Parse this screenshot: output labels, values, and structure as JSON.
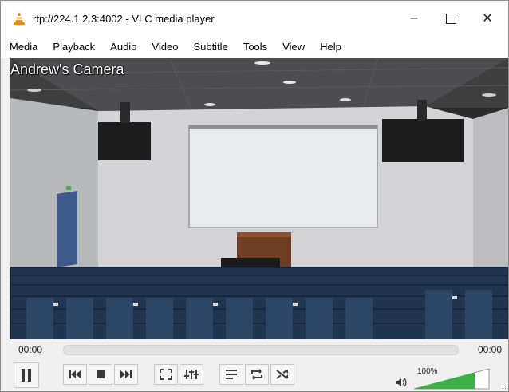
{
  "window": {
    "title": "rtp://224.1.2.3:4002 - VLC media player",
    "min_glyph": "–",
    "close_glyph": "✕"
  },
  "menu": {
    "items": [
      "Media",
      "Playback",
      "Audio",
      "Video",
      "Subtitle",
      "Tools",
      "View",
      "Help"
    ]
  },
  "video": {
    "overlay_text": "Andrew's Camera"
  },
  "seek": {
    "elapsed": "00:00",
    "total": "00:00",
    "progress": 0.0
  },
  "volume": {
    "label": "100%",
    "level": 1.0
  },
  "icons": {
    "app": "vlc-cone-icon",
    "pause": "pause-icon",
    "prev": "previous-icon",
    "stop": "stop-icon",
    "next": "next-icon",
    "fullscreen": "fullscreen-icon",
    "extended": "extended-settings-icon",
    "playlist": "playlist-icon",
    "loop": "loop-icon",
    "random": "random-icon",
    "speaker": "speaker-icon"
  },
  "colors": {
    "accent_orange": "#f08a00",
    "volume_green": "#3cb043",
    "wall": "#cfcfd0",
    "seats": "#1f3550"
  }
}
